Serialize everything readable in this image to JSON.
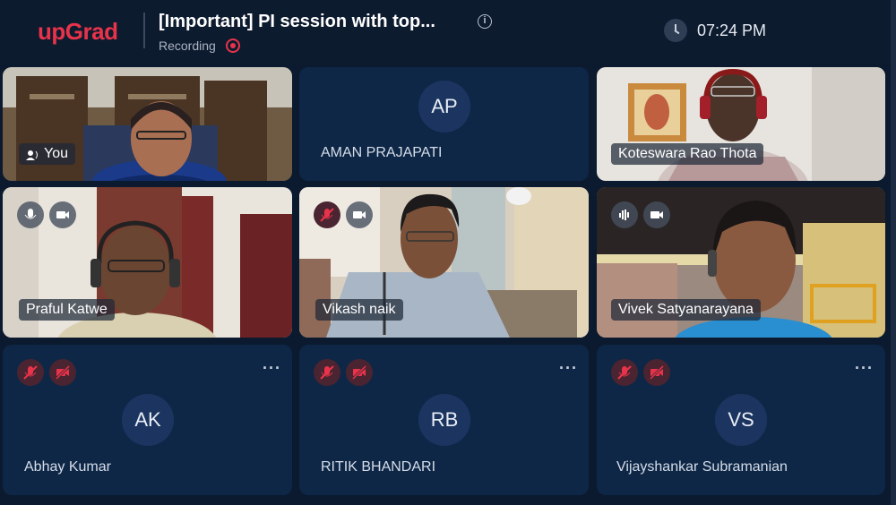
{
  "header": {
    "logo": "upGrad",
    "title": "[Important] PI session with top...",
    "recording_label": "Recording",
    "time": "07:24 PM"
  },
  "tiles": [
    {
      "name": "You"
    },
    {
      "name": "AMAN PRAJAPATI",
      "initials": "AP"
    },
    {
      "name": "Koteswara Rao Thota"
    },
    {
      "name": "Praful Katwe"
    },
    {
      "name": "Vikash naik"
    },
    {
      "name": "Vivek Satyanarayana"
    },
    {
      "name": "Abhay Kumar",
      "initials": "AK"
    },
    {
      "name": "RITIK BHANDARI",
      "initials": "RB"
    },
    {
      "name": "Vijayshankar Subramanian",
      "initials": "VS"
    }
  ],
  "colors": {
    "brand": "#e8334a",
    "tile_bg": "#0e2747",
    "page_bg": "#0b1a2e"
  },
  "icons": [
    "info-icon",
    "recording-dot-icon",
    "clock-icon",
    "mic-icon",
    "mic-muted-icon",
    "camera-icon",
    "camera-off-icon",
    "audio-wave-icon",
    "more-options-icon"
  ]
}
